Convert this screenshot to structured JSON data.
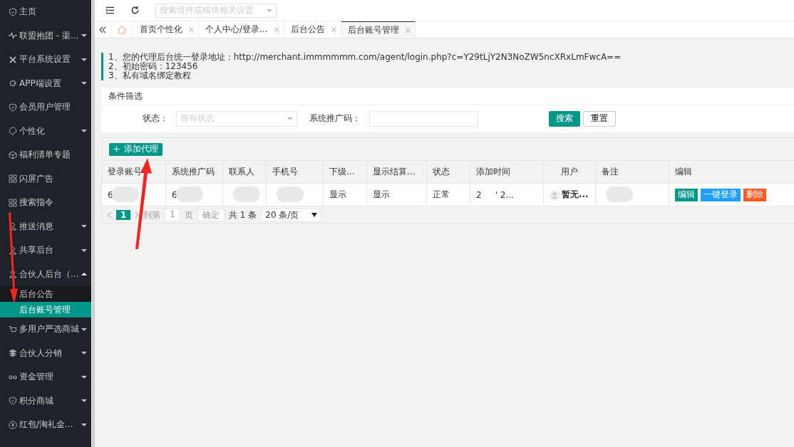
{
  "sidebar": {
    "items": [
      {
        "label": "主页",
        "has_arrow": false,
        "selected": false
      },
      {
        "label": "联盟抱团 - 渠...",
        "has_arrow": true,
        "expanded": false,
        "selected": false
      },
      {
        "label": "平台系统设置",
        "has_arrow": true,
        "expanded": false,
        "selected": false
      },
      {
        "label": "APP端设置",
        "has_arrow": true,
        "expanded": false,
        "selected": false
      },
      {
        "label": "会员用户管理",
        "has_arrow": false,
        "selected": false
      },
      {
        "label": "个性化",
        "has_arrow": true,
        "expanded": false,
        "selected": false
      },
      {
        "label": "福利清单专题",
        "has_arrow": false,
        "selected": false
      },
      {
        "label": "闪屏广告",
        "has_arrow": false,
        "selected": false
      },
      {
        "label": "搜索指令",
        "has_arrow": false,
        "selected": false
      },
      {
        "label": "推送消息",
        "has_arrow": true,
        "expanded": false,
        "selected": false
      },
      {
        "label": "共享后台",
        "has_arrow": true,
        "expanded": false,
        "selected": false
      },
      {
        "label": "合伙人后台（...",
        "has_arrow": true,
        "expanded": true,
        "selected": false,
        "children": [
          {
            "label": "后台公告",
            "selected": false
          },
          {
            "label": "后台账号管理",
            "selected": true
          }
        ]
      },
      {
        "label": "多用户严选商城",
        "has_arrow": true,
        "expanded": false,
        "selected": false
      },
      {
        "label": "合伙人分销",
        "has_arrow": true,
        "expanded": false,
        "selected": false
      },
      {
        "label": "资金管理",
        "has_arrow": true,
        "expanded": false,
        "selected": false
      },
      {
        "label": "积分商城",
        "has_arrow": true,
        "expanded": false,
        "selected": false
      },
      {
        "label": "红包/淘礼金...",
        "has_arrow": true,
        "expanded": false,
        "selected": false
      }
    ]
  },
  "topbar": {
    "search": {
      "placeholder": "搜索组件或模块相关设置"
    }
  },
  "tabs": [
    {
      "label": "首页个性化",
      "selected": false
    },
    {
      "label": "个人中心/登录...",
      "selected": false
    },
    {
      "label": "后台公告",
      "selected": false
    },
    {
      "label": "后台账号管理",
      "selected": true
    }
  ],
  "notice": [
    "1、您的代理后台统一登录地址：http://merchant.immmmmm.com/agent/login.php?c=Y29tLjY2N3NoZW5ncXRxLmFwcA==",
    "2、初始密码：123456",
    "3、私有域名绑定教程"
  ],
  "filter": {
    "title": "条件筛选",
    "status_label": "状态：",
    "status_placeholder": "所有状态",
    "code_label": "系统推广码：",
    "search_button": "搜索",
    "reset_button": "重置"
  },
  "add_button": "添加代理",
  "table": {
    "columns": [
      "登录账号",
      "系统推广码",
      "联系人",
      "手机号",
      "下级...",
      "显示结算...",
      "状态",
      "添加时间",
      "用户",
      "备注",
      "编辑"
    ],
    "rows": [
      {
        "cells": [
          "6",
          "6",
          "",
          "",
          "显示",
          "显示",
          "正常",
          "2     ' 2...",
          "暂无...",
          ""
        ],
        "actions": [
          {
            "label": "编辑",
            "kind": "edit"
          },
          {
            "label": "一键登录",
            "kind": "login"
          },
          {
            "label": "删除",
            "kind": "delete"
          }
        ]
      }
    ]
  },
  "pager": {
    "current": "1",
    "goto_label": "到第",
    "goto_value": "1",
    "page_label": "页",
    "confirm": "确定",
    "total": "共 1 条",
    "page_size": "20 条/页"
  }
}
